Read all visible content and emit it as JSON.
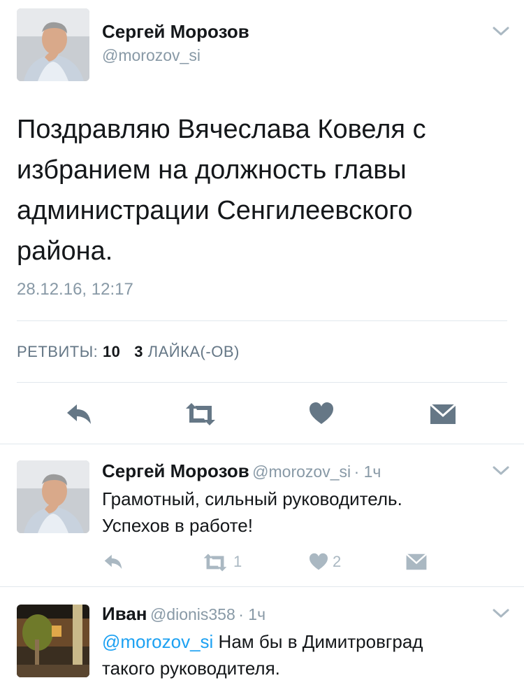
{
  "main_tweet": {
    "author_name": "Сергей Морозов",
    "author_handle": "@morozov_si",
    "text": "Поздравляю Вячеслава Ковеля с избранием на должность главы администрации Сенгилеевского района.",
    "timestamp": "28.12.16, 12:17",
    "retweets_label": "РЕТВИТЫ:",
    "retweets_count": "10",
    "likes_count": "3",
    "likes_label": "ЛАЙКА(-ОВ)",
    "actions": [
      "reply-icon",
      "retweet-icon",
      "heart-icon",
      "message-icon"
    ]
  },
  "replies": [
    {
      "author_name": "Сергей Морозов",
      "author_handle": "@morozov_si",
      "time": "· 1ч",
      "line1": "Грамотный, сильный руководитель.",
      "line2": "Успехов в работе!",
      "retweet_count": "1",
      "like_count": "2"
    },
    {
      "author_name": "Иван",
      "author_handle": "@dionis358",
      "time": "· 1ч",
      "mention": "@morozov_si",
      "line1_rest": " Нам бы в Димитровград",
      "line2": "такого руководителя."
    }
  ],
  "colors": {
    "text": "#14171a",
    "muted": "#8899a6",
    "icon": "#657786",
    "light_icon": "#aab8c2",
    "link": "#1da1f2",
    "divider": "#e1e8ed"
  }
}
